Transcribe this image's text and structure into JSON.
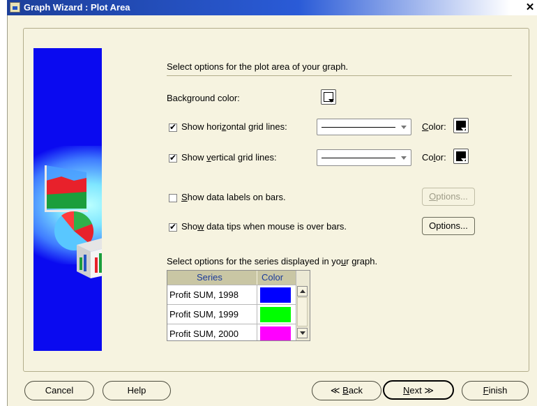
{
  "window": {
    "title": "Graph Wizard : Plot Area",
    "close_glyph": "✕"
  },
  "plot_area": {
    "heading": "Select options for the plot area of your graph.",
    "background_color_label": "Background color:",
    "horizontal_grid_label": "Show horizontal grid lines:",
    "horizontal_grid_checked": true,
    "vertical_grid_label": "Show vertical grid lines:",
    "vertical_grid_checked": true,
    "color_label": "Color:",
    "data_labels_label": "Show data labels on bars.",
    "data_labels_checked": false,
    "data_tips_label": "Show data tips when mouse is over bars.",
    "data_tips_checked": true,
    "options_label": "Options..."
  },
  "series": {
    "heading": "Select options for the series displayed in your graph.",
    "columns": [
      "Series",
      "Color"
    ],
    "rows": [
      {
        "name": "Profit SUM, 1998",
        "color": "#0000ff"
      },
      {
        "name": "Profit SUM, 1999",
        "color": "#00ff00"
      },
      {
        "name": "Profit SUM, 2000",
        "color": "#ff00ff"
      }
    ]
  },
  "footer": {
    "cancel": "Cancel",
    "help": "Help",
    "back": "Back",
    "next": "Next",
    "finish": "Finish"
  }
}
